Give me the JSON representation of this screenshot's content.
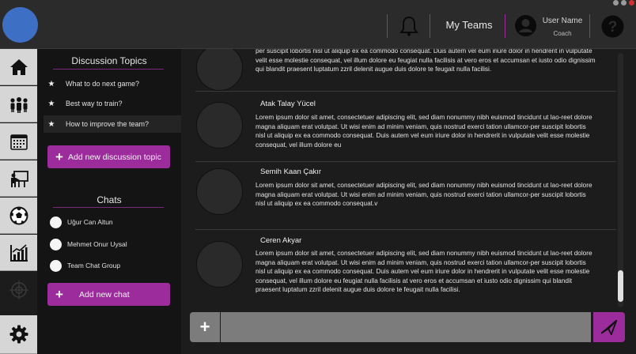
{
  "header": {
    "my_teams_label": "My Teams",
    "user_name": "User Name",
    "user_role": "Coach",
    "divider_color": "#9b2c9b",
    "brand_color": "#3d6fc4"
  },
  "iconbar": {
    "items": [
      "home-icon",
      "team-icon",
      "calendar-icon",
      "tactics-board-icon",
      "football-icon",
      "stats-chart-icon",
      "target-icon",
      "gear-icon"
    ]
  },
  "sidebar": {
    "topics_title": "Discussion Topics",
    "topics": [
      {
        "label": "What to do next game?"
      },
      {
        "label": "Best way to train?"
      },
      {
        "label": "How to improve the team?"
      }
    ],
    "add_topic_label": "Add new discussion topic",
    "chats_title": "Chats",
    "chats": [
      {
        "label": "Uğur Can Altun"
      },
      {
        "label": "Mehmet Onur Uysal"
      },
      {
        "label": "Team Chat Group"
      }
    ],
    "add_chat_label": "Add new chat",
    "accent_color": "#9c2c9c"
  },
  "messages": [
    {
      "name": "",
      "text": "per suscipit lobortis nisl ut aliquip ex ea commodo consequat. Duis autem vel eum iriure dolor in hendrerit in vulputate velit esse molestie consequat, vel illum dolore eu feugiat nulla facilisis at vero eros et accumsan et iusto odio dignissim qui blandit praesent luptatum zzril delenit augue duis dolore te feugait nulla facilisi."
    },
    {
      "name": "Atak Talay Yücel",
      "text": "Lorem ipsum dolor sit amet, consectetuer adipiscing elit, sed diam nonummy nibh euismod tincidunt ut lao-reet dolore magna aliquam erat volutpat. Ut wisi enim ad minim veniam, quis nostrud exerci tation ullamcor-per suscipit lobortis nisl ut aliquip ex ea commodo consequat. Duis autem vel eum iriure dolor in hendrerit in vulputate velit esse molestie consequat, vel illum dolore eu"
    },
    {
      "name": "Semih Kaan Çakır",
      "text": "Lorem ipsum dolor sit amet, consectetuer adipiscing elit, sed diam nonummy nibh euismod tincidunt ut lao-reet dolore magna aliquam erat volutpat. Ut wisi enim ad minim veniam, quis nostrud exerci tation ullamcor-per suscipit lobortis nisl ut aliquip ex ea commodo consequat.v"
    },
    {
      "name": "Ceren Akyar",
      "text": "Lorem ipsum dolor sit amet, consectetuer adipiscing elit, sed diam nonummy nibh euismod tincidunt ut lao-reet dolore magna aliquam erat volutpat. Ut wisi enim ad minim veniam, quis nostrud exerci tation ullamcor-per suscipit lobortis nisl ut aliquip ex ea commodo consequat. Duis autem vel eum iriure dolor in hendrerit in vulputate velit esse molestie consequat, vel illum dolore eu feugiat nulla facilisis at vero eros et accumsan et iusto odio dignissim qui blandit praesent luptatum zzril delenit augue duis dolore te feugait nulla facilisi."
    }
  ],
  "composer": {
    "input_value": "",
    "input_placeholder": "",
    "add_icon": "plus-icon",
    "send_icon": "send-icon"
  }
}
